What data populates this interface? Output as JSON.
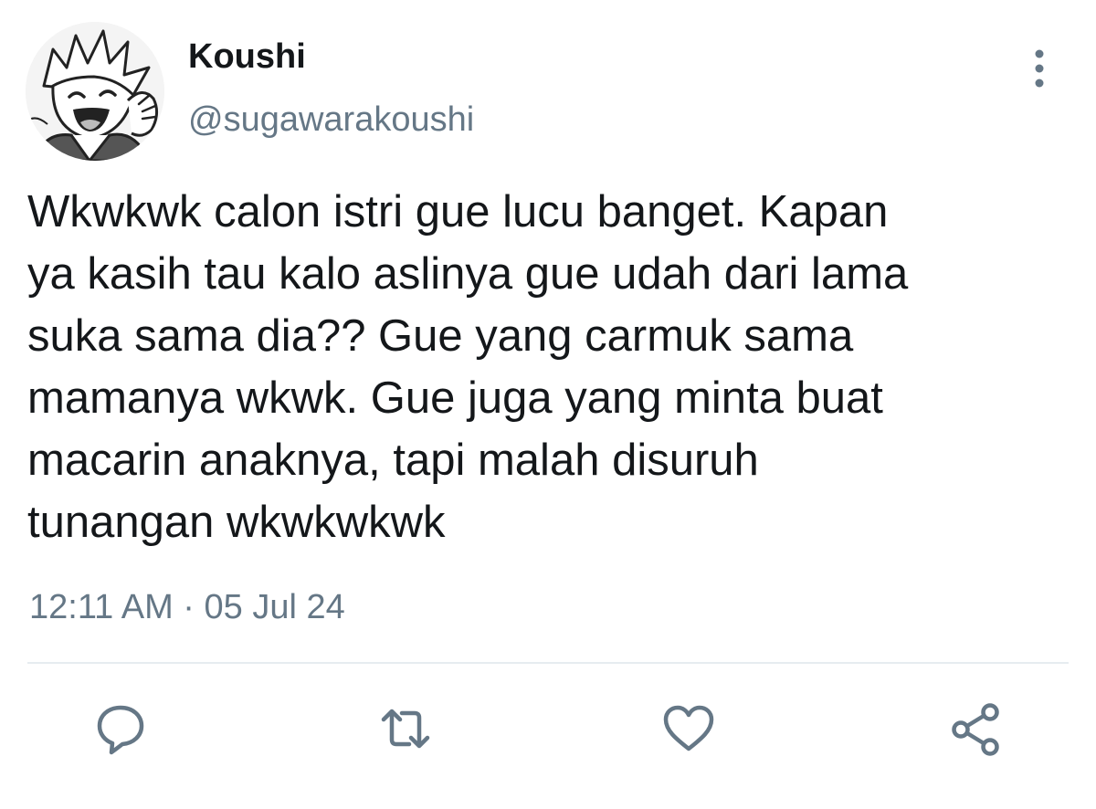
{
  "tweet": {
    "author": {
      "display_name": "Koushi",
      "handle": "@sugawarakoushi",
      "avatar_icon": "anime-avatar-icon"
    },
    "text": "Wkwkwk calon istri gue lucu banget. Kapan\nya kasih tau kalo aslinya gue udah dari lama\nsuka sama dia?? Gue yang carmuk sama\nmamanya wkwk. Gue juga yang minta buat\nmacarin anaknya, tapi malah disuruh\ntunangan wkwkwkwk",
    "timestamp": "12:11 AM · 05 Jul 24",
    "menu_icon": "more-vertical-icon",
    "actions": [
      {
        "name": "reply",
        "icon": "reply-icon"
      },
      {
        "name": "retweet",
        "icon": "retweet-icon"
      },
      {
        "name": "like",
        "icon": "heart-icon"
      },
      {
        "name": "share",
        "icon": "share-icon"
      }
    ]
  },
  "colors": {
    "text_primary": "#14171a",
    "text_secondary": "#657786",
    "icon": "#657786",
    "divider": "#e6ecf0"
  }
}
